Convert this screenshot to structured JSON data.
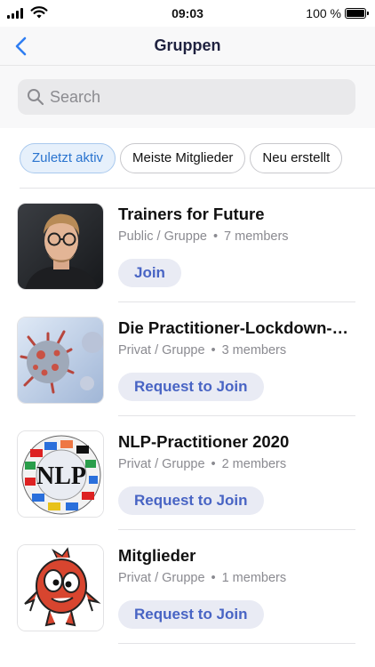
{
  "status_bar": {
    "time": "09:03",
    "battery": "100 %"
  },
  "nav": {
    "title": "Gruppen"
  },
  "search": {
    "placeholder": "Search"
  },
  "filters": [
    {
      "label": "Zuletzt aktiv",
      "active": true
    },
    {
      "label": "Meiste Mitglieder",
      "active": false
    },
    {
      "label": "Neu erstellt",
      "active": false
    }
  ],
  "groups": [
    {
      "name": "Trainers for Future",
      "visibility": "Public / Gruppe",
      "members": "7 members",
      "action": "Join",
      "avatar": "portrait-photo"
    },
    {
      "name": "Die Practitioner-Lockdown-Gruppe",
      "visibility": "Privat / Gruppe",
      "members": "3 members",
      "action": "Request to Join",
      "avatar": "virus-image"
    },
    {
      "name": "NLP-Practitioner 2020",
      "visibility": "Privat / Gruppe",
      "members": "2 members",
      "action": "Request to Join",
      "avatar": "nlp-flags-logo",
      "logo_text": "NLP"
    },
    {
      "name": "Mitglieder",
      "visibility": "Privat / Gruppe",
      "members": "1 members",
      "action": "Request to Join",
      "avatar": "red-monster-mascot"
    }
  ]
}
